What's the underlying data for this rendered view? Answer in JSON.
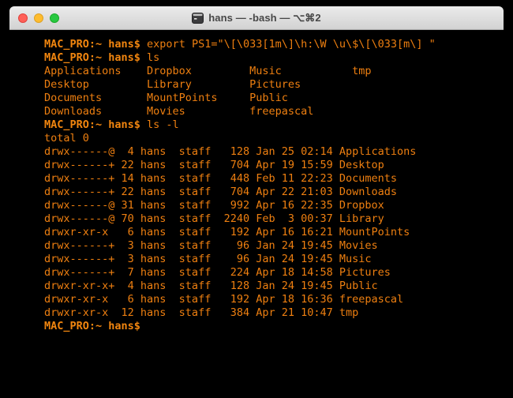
{
  "window": {
    "title": "hans — -bash — ⌥⌘2",
    "controls": {
      "close": "close",
      "minimize": "minimize",
      "zoom": "zoom"
    }
  },
  "colors": {
    "terminal_background": "#000000",
    "terminal_text": "#ee7f10",
    "titlebar": "#d8d8d8",
    "close": "#ff5f57",
    "minimize": "#febc2e",
    "zoom": "#28c840"
  },
  "terminal": {
    "prompt": "MAC_PRO:~ hans$",
    "lines": [
      {
        "prompt": "MAC_PRO:~ hans$",
        "cmd": " export PS1=\"\\[\\033[1m\\]\\h:\\W \\u\\$\\[\\033[m\\] \""
      },
      {
        "prompt": "MAC_PRO:~ hans$",
        "cmd": " ls"
      },
      {
        "text": "Applications    Dropbox         Music           tmp"
      },
      {
        "text": "Desktop         Library         Pictures"
      },
      {
        "text": "Documents       MountPoints     Public"
      },
      {
        "text": "Downloads       Movies          freepascal"
      },
      {
        "prompt": "MAC_PRO:~ hans$",
        "cmd": " ls -l"
      },
      {
        "text": "total 0"
      },
      {
        "text": "drwx------@  4 hans  staff   128 Jan 25 02:14 Applications"
      },
      {
        "text": "drwx------+ 22 hans  staff   704 Apr 19 15:59 Desktop"
      },
      {
        "text": "drwx------+ 14 hans  staff   448 Feb 11 22:23 Documents"
      },
      {
        "text": "drwx------+ 22 hans  staff   704 Apr 22 21:03 Downloads"
      },
      {
        "text": "drwx------@ 31 hans  staff   992 Apr 16 22:35 Dropbox"
      },
      {
        "text": "drwx------@ 70 hans  staff  2240 Feb  3 00:37 Library"
      },
      {
        "text": "drwxr-xr-x   6 hans  staff   192 Apr 16 16:21 MountPoints"
      },
      {
        "text": "drwx------+  3 hans  staff    96 Jan 24 19:45 Movies"
      },
      {
        "text": "drwx------+  3 hans  staff    96 Jan 24 19:45 Music"
      },
      {
        "text": "drwx------+  7 hans  staff   224 Apr 18 14:58 Pictures"
      },
      {
        "text": "drwxr-xr-x+  4 hans  staff   128 Jan 24 19:45 Public"
      },
      {
        "text": "drwxr-xr-x   6 hans  staff   192 Apr 18 16:36 freepascal"
      },
      {
        "text": "drwxr-xr-x  12 hans  staff   384 Apr 21 10:47 tmp"
      },
      {
        "prompt": "MAC_PRO:~ hans$",
        "cmd": ""
      }
    ]
  }
}
